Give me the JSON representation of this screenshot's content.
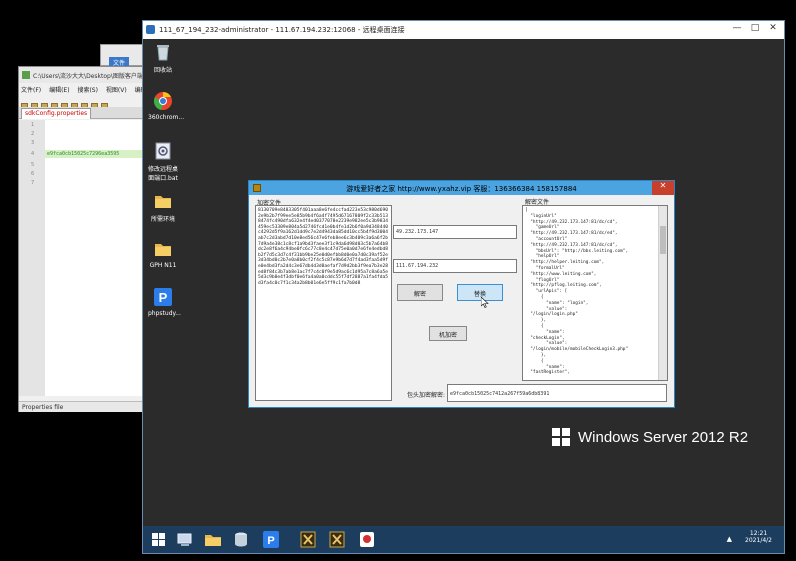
{
  "notepad": {
    "title": "C:\\Users\\流沙大大\\Desktop\\图版客户端",
    "menu": [
      "文件(F)",
      "编辑(E)",
      "搜索(S)",
      "视图(V)",
      "编码"
    ],
    "tab": "sdkConfig.properties",
    "line_numbers": [
      "1",
      "2",
      "3",
      "4",
      "5",
      "6",
      "7"
    ],
    "code_line": "e9fca0cb15025c7296ea3595",
    "status": "Properties file"
  },
  "behind_window": {
    "tab": "文件"
  },
  "remote_desktop": {
    "title": "111_67_194_232-administrator - 111.67.194.232:12068 - 远程桌面连接",
    "controls": [
      "—",
      "□",
      "✕"
    ]
  },
  "desktop_icons": [
    {
      "label": "回收站",
      "icon": "recycle-bin-icon"
    },
    {
      "label": "360chrom...",
      "icon": "browser-icon"
    },
    {
      "label": "修改远程桌面端口.bat",
      "icon": "bat-file-icon"
    },
    {
      "label": "所需环境",
      "icon": "folder-icon"
    },
    {
      "label": "GPH N11",
      "icon": "folder-icon"
    },
    {
      "label": "phpstudy...",
      "icon": "phpstudy-icon"
    }
  ],
  "app": {
    "title": "游戏爱好者之家 http://www.yxahz.vip 客服：136366384 158157884",
    "encrypted_label": "加密文件",
    "encrypted_text": "8130709e8483305f401aaa8e6fe4ccfad223e53c980d6902e9b2b7f99ee5e85b9b4f6a4f7495d67167809f2c33b5138474fc490dfa632e4f4ed0377078e2239e982ee5c3b9834459ec53309e804a5d2746fcd1e0b4fe1d2b6f0a9d348440c4292d5f9a162d1dd9c7e2d4943da85dd10cc5b4f9d3004ab7c2d3abd7d10e8ed56c47e6feb8ee6c3b409c3a6a6f2b7d9a4e38c1c8cf1a9bd3faee3f1c9da6d98d03c5b7a64b8dc2e8f6a4c94be0fc6c77c8e4c47d75e0a0d7e6fe4edbd8b2f7d5c3d7c4f31bb9be25e0d0efbb8d0e0a7d0c39af52e3d34bd0c2b7e0a8b0cf2f4c5c87e9b6d7d7f4ad3faa5d9fe0e4bd3fa2d4c3e67db4d3d8aefaf7d9d2bb3f9ea7b3e28ed8f84c3b7ab8e1ac7f7c4c0f9e5d9ac6c1d95a7c8a6a5e5d3c9b0e4f3dbf0e6fa4a0a0cddc55f7df2887a1fa4fda5d3fa4c0c7f1c34a2b8b01e6e5ff9c1fa7b0d8",
    "ip1": "49.232.173.147",
    "ip2": "111.67.194.232",
    "btn_decrypt": "解密",
    "btn_replace": "替换",
    "btn_encrypt": "机加密",
    "key_label": "包头加密解密:",
    "key_value": "e9fca0cb15025c7412a267f59a6db8391",
    "decrypted_label": "解密文件",
    "decrypted_text": "[\n  \"loginUrl\"\n  \"http://49.232.173.147:81/dc/cd\",\n    \"gameUrl\"\n  \"http://49.232.173.147:81/dc/ed\",\n    \"accountUrl\"\n  \"http://49.232.173.147:81/dc/cd\",\n    \"bbsUrl\": \"http://bbs.leiting.com\",\n    \"helpUrl\"\n  \"http://helper.leiting.com\",\n    \"formalUrl\"\n  \"http://www.leiting.com\",\n    \"flogUrl\"\n  \"http://pflog.leiting.com\",\n    \"urlApis\": [\n      {\n        \"name\": \"login\",\n        \"value\":\n  \"/login/login.php\"\n      },\n      {\n        \"name\":\n  \"checkLogin\",\n        \"value\":\n  \"/login/mobile/mobileCheckLogin3.php\"\n      },\n      {\n        \"name\":\n  \"fastRegister\","
  },
  "watermark": "Windows Server 2012 R2",
  "taskbar": {
    "items": [
      "start-icon",
      "server-manager-icon",
      "explorer-icon",
      "database-icon",
      "phpstudy-icon",
      "game-tool-icon",
      "game-tool-icon",
      "card-game-icon"
    ],
    "time": "12:21",
    "date": "2021/4/2"
  },
  "colors": {
    "accent": "#4ba3e0",
    "taskbar": "#1d3d5f",
    "desktop": "#2b2b2b"
  }
}
